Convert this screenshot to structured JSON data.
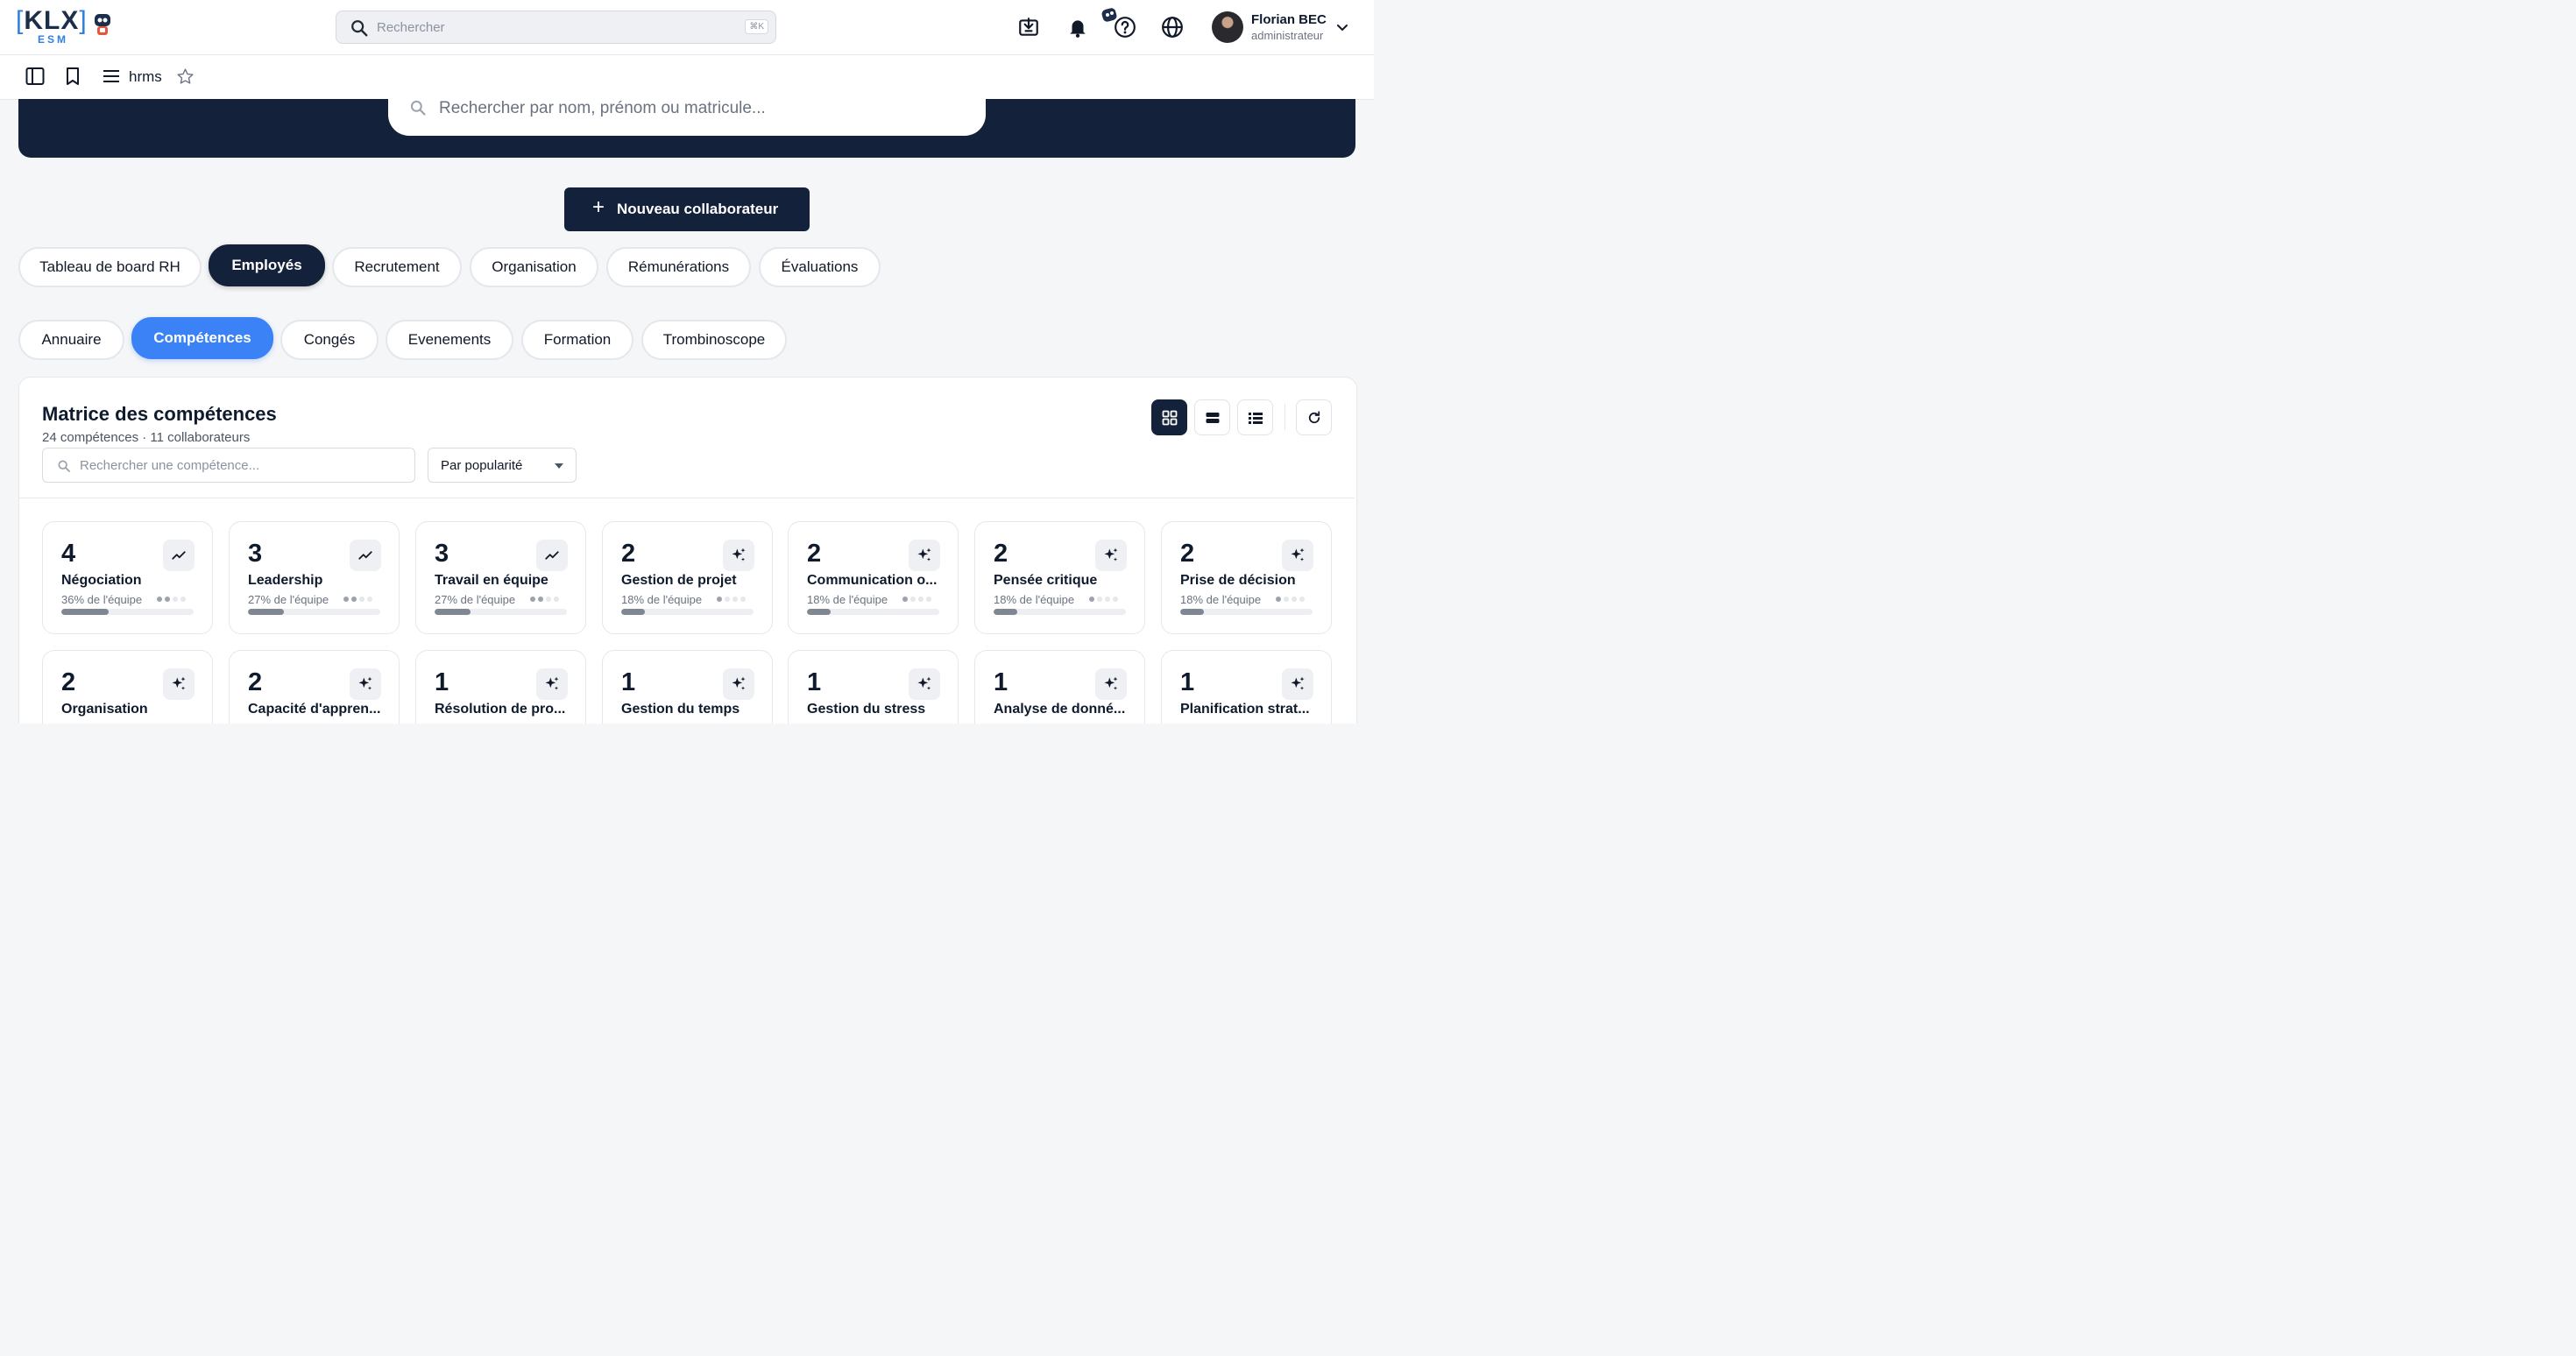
{
  "topbar": {
    "logo_text": "KLX",
    "logo_sub": "ESM",
    "search_placeholder": "Rechercher",
    "search_shortcut": "⌘K",
    "user_name": "Florian BEC",
    "user_role": "administrateur",
    "icons": [
      "download-icon",
      "bell-icon",
      "help-icon",
      "globe-icon",
      "chevron-down-icon"
    ]
  },
  "subbar": {
    "module_name": "hrms",
    "icons": [
      "sidebar-toggle-icon",
      "bookmark-icon",
      "menu-icon",
      "star-icon"
    ]
  },
  "hero": {
    "search_placeholder": "Rechercher par nom, prénom ou matricule..."
  },
  "new_button_label": "Nouveau collaborateur",
  "main_tabs": [
    {
      "label": "Tableau de board RH"
    },
    {
      "label": "Employés",
      "active": true
    },
    {
      "label": "Recrutement"
    },
    {
      "label": "Organisation"
    },
    {
      "label": "Rémunérations"
    },
    {
      "label": "Évaluations"
    }
  ],
  "sub_tabs": [
    {
      "label": "Annuaire"
    },
    {
      "label": "Compétences",
      "active": true
    },
    {
      "label": "Congés"
    },
    {
      "label": "Evenements"
    },
    {
      "label": "Formation"
    },
    {
      "label": "Trombinoscope"
    }
  ],
  "matrix": {
    "title": "Matrice des compétences",
    "subtitle": "24 compétences · 11 collaborateurs",
    "search_placeholder": "Rechercher une compétence...",
    "sort_value": "Par popularité",
    "view_buttons": [
      "grid-view-icon",
      "compact-view-icon",
      "list-view-icon",
      "refresh-icon"
    ]
  },
  "skills": [
    {
      "count": "4",
      "name": "Négociation",
      "pct": "36% de l'équipe",
      "level": 2,
      "fill": 0.36,
      "icon": "trend-icon"
    },
    {
      "count": "3",
      "name": "Leadership",
      "pct": "27% de l'équipe",
      "level": 2,
      "fill": 0.27,
      "icon": "trend-icon"
    },
    {
      "count": "3",
      "name": "Travail en équipe",
      "pct": "27% de l'équipe",
      "level": 2,
      "fill": 0.27,
      "icon": "trend-icon"
    },
    {
      "count": "2",
      "name": "Gestion de projet",
      "pct": "18% de l'équipe",
      "level": 1,
      "fill": 0.18,
      "icon": "sparkle-icon"
    },
    {
      "count": "2",
      "name": "Communication o...",
      "pct": "18% de l'équipe",
      "level": 1,
      "fill": 0.18,
      "icon": "sparkle-icon"
    },
    {
      "count": "2",
      "name": "Pensée critique",
      "pct": "18% de l'équipe",
      "level": 1,
      "fill": 0.18,
      "icon": "sparkle-icon"
    },
    {
      "count": "2",
      "name": "Prise de décision",
      "pct": "18% de l'équipe",
      "level": 1,
      "fill": 0.18,
      "icon": "sparkle-icon"
    },
    {
      "count": "2",
      "name": "Organisation",
      "pct": "",
      "level": 0,
      "fill": 0,
      "icon": "sparkle-icon"
    },
    {
      "count": "2",
      "name": "Capacité d'appren...",
      "pct": "",
      "level": 0,
      "fill": 0,
      "icon": "sparkle-icon"
    },
    {
      "count": "1",
      "name": "Résolution de pro...",
      "pct": "",
      "level": 0,
      "fill": 0,
      "icon": "sparkle-icon"
    },
    {
      "count": "1",
      "name": "Gestion du temps",
      "pct": "",
      "level": 0,
      "fill": 0,
      "icon": "sparkle-icon"
    },
    {
      "count": "1",
      "name": "Gestion du stress",
      "pct": "",
      "level": 0,
      "fill": 0,
      "icon": "sparkle-icon"
    },
    {
      "count": "1",
      "name": "Analyse de donné...",
      "pct": "",
      "level": 0,
      "fill": 0,
      "icon": "sparkle-icon"
    },
    {
      "count": "1",
      "name": "Planification strat...",
      "pct": "",
      "level": 0,
      "fill": 0,
      "icon": "sparkle-icon"
    }
  ]
}
